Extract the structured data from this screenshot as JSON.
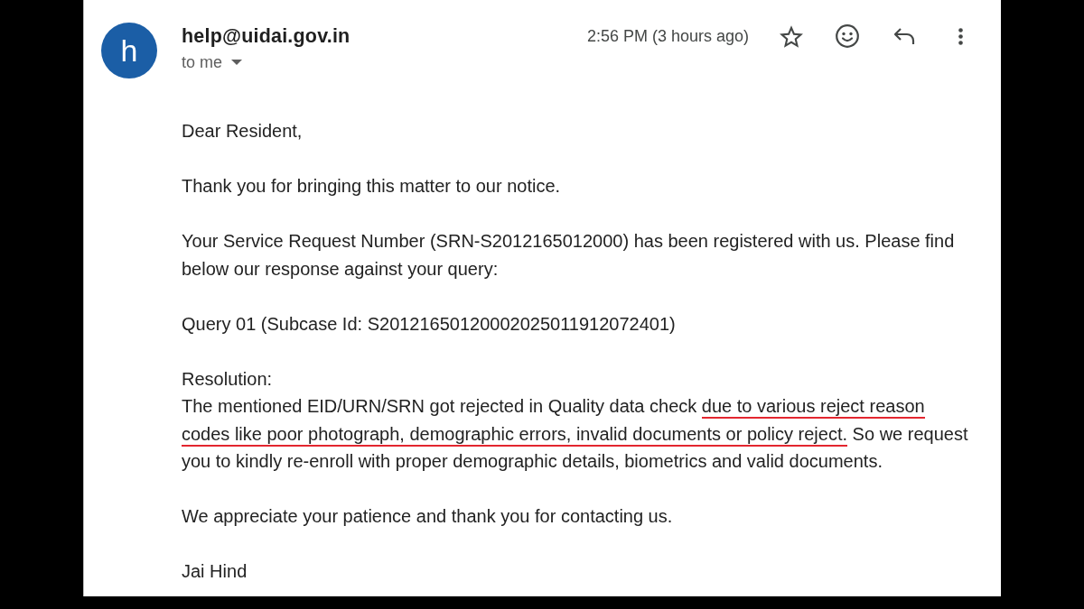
{
  "header": {
    "avatar_letter": "h",
    "sender": "help@uidai.gov.in",
    "recipient": "to me",
    "timestamp": "2:56 PM (3 hours ago)",
    "starred": false
  },
  "body": [
    {
      "text": "Dear Resident,"
    },
    {
      "text": "Thank you for bringing this matter to our notice."
    },
    {
      "text": "Your Service Request Number (SRN-S2012165012000) has been registered with us. Please find below our response against your query:"
    },
    {
      "text": "Query 01 (Subcase Id: S20121650120002025011912072401)"
    },
    {
      "heading": "Resolution:",
      "segments": [
        {
          "text": "The mentioned EID/URN/SRN got rejected in Quality data check ",
          "underlined": false
        },
        {
          "text": "due to various reject reason codes like poor photograph, demographic errors, invalid documents or policy reject.",
          "underlined": true
        },
        {
          "text": " So we request you to kindly re-enroll with proper demographic details, biometrics and valid documents.",
          "underlined": false
        }
      ]
    },
    {
      "text": "We appreciate your patience and thank you for contacting us."
    },
    {
      "text": "Jai Hind"
    }
  ]
}
